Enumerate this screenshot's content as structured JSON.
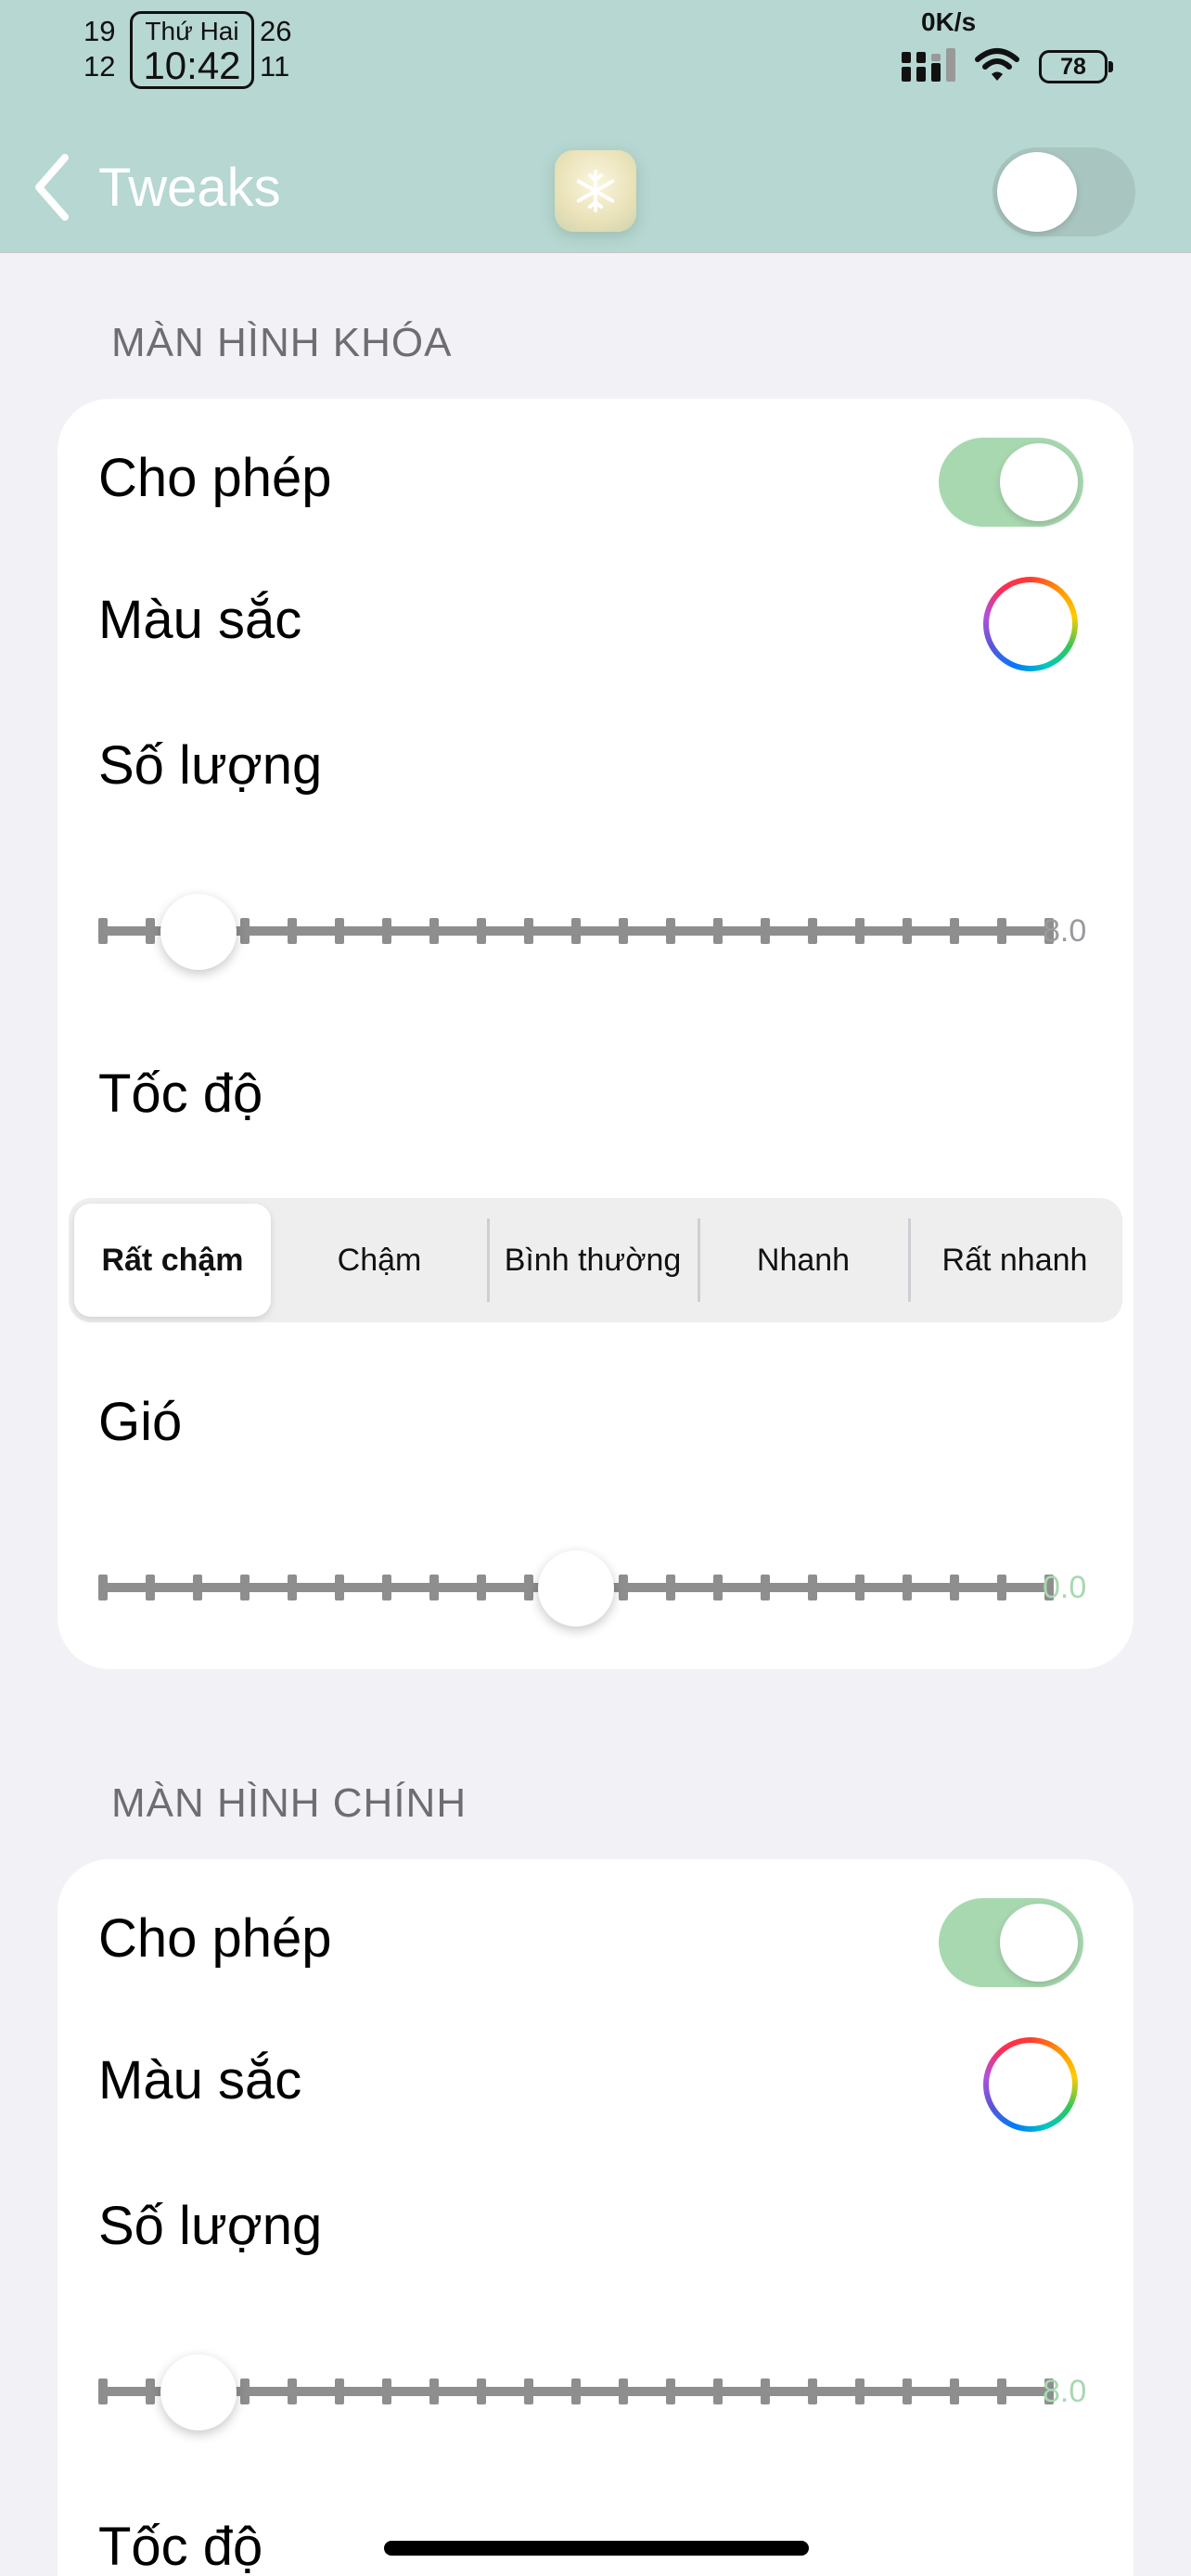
{
  "status_bar": {
    "date_tl": "19",
    "date_bl": "12",
    "clock_day": "Thứ Hai",
    "clock_time": "10:42",
    "date_tr": "26",
    "date_br": "11",
    "net_speed": "0K/s",
    "battery": "78",
    "icons": [
      "signal-bars-icon",
      "wifi-icon",
      "battery-icon"
    ]
  },
  "nav": {
    "back_label": "Tweaks",
    "icon": "snowflake-app-icon",
    "toggle_on": false
  },
  "sections": [
    {
      "header": "MÀN HÌNH KHÓA",
      "enable_label": "Cho phép",
      "enable_on": true,
      "color_label": "Màu sắc",
      "amount_label": "Số lượng",
      "amount_value": "8.0",
      "speed_label": "Tốc độ",
      "speed_options": [
        "Rất chậm",
        "Chậm",
        "Bình thường",
        "Nhanh",
        "Rất nhanh"
      ],
      "speed_selected": "Rất chậm",
      "wind_label": "Gió",
      "wind_value": "0.0"
    },
    {
      "header": "MÀN HÌNH CHÍNH",
      "enable_label": "Cho phép",
      "enable_on": true,
      "color_label": "Màu sắc",
      "amount_label": "Số lượng",
      "amount_value": "8.0",
      "speed_label": "Tốc độ"
    }
  ],
  "colors": {
    "header_bg": "#b6d7d2",
    "toggle_on": "#a8d8b0",
    "page_bg": "#f2f2f6"
  }
}
